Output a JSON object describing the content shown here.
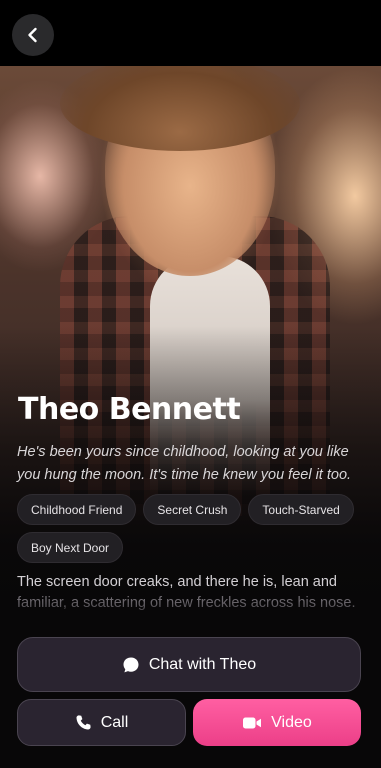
{
  "profile": {
    "name": "Theo Bennett",
    "tagline": "He's been yours since childhood, looking at you like you hung the moon. It's time he knew you feel it too.",
    "tags": [
      "Childhood Friend",
      "Secret Crush",
      "Touch-Starved",
      "Boy Next Door"
    ],
    "description_line1": "The screen door creaks, and there he is, lean and",
    "description_line2": "familiar, a scattering of new freckles across his nose."
  },
  "actions": {
    "chat_label": "Chat with Theo",
    "call_label": "Call",
    "video_label": "Video"
  },
  "colors": {
    "accent": "#ec3f88",
    "button_dark": "#2a2430",
    "background": "#080708"
  },
  "icons": {
    "back": "chevron-left-icon",
    "chat": "chat-bubble-icon",
    "call": "phone-icon",
    "video": "video-camera-icon"
  }
}
